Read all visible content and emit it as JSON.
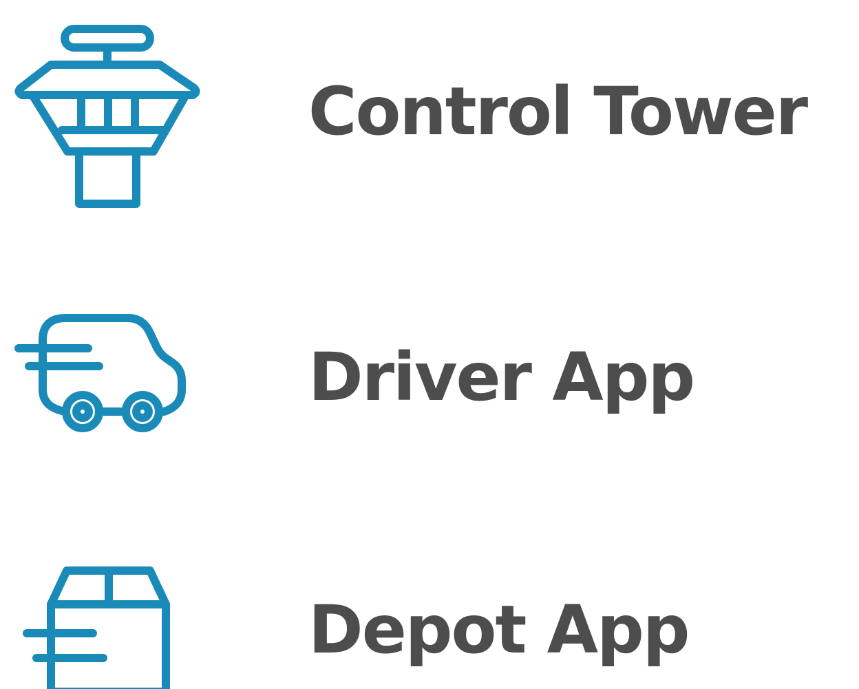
{
  "colors": {
    "icon": "#1a8ab8",
    "text": "#4d4d4d",
    "background": "#ffffff"
  },
  "items": [
    {
      "label": "Control Tower",
      "icon": "control-tower-icon"
    },
    {
      "label": "Driver App",
      "icon": "delivery-van-icon"
    },
    {
      "label": "Depot App",
      "icon": "package-box-icon"
    }
  ]
}
